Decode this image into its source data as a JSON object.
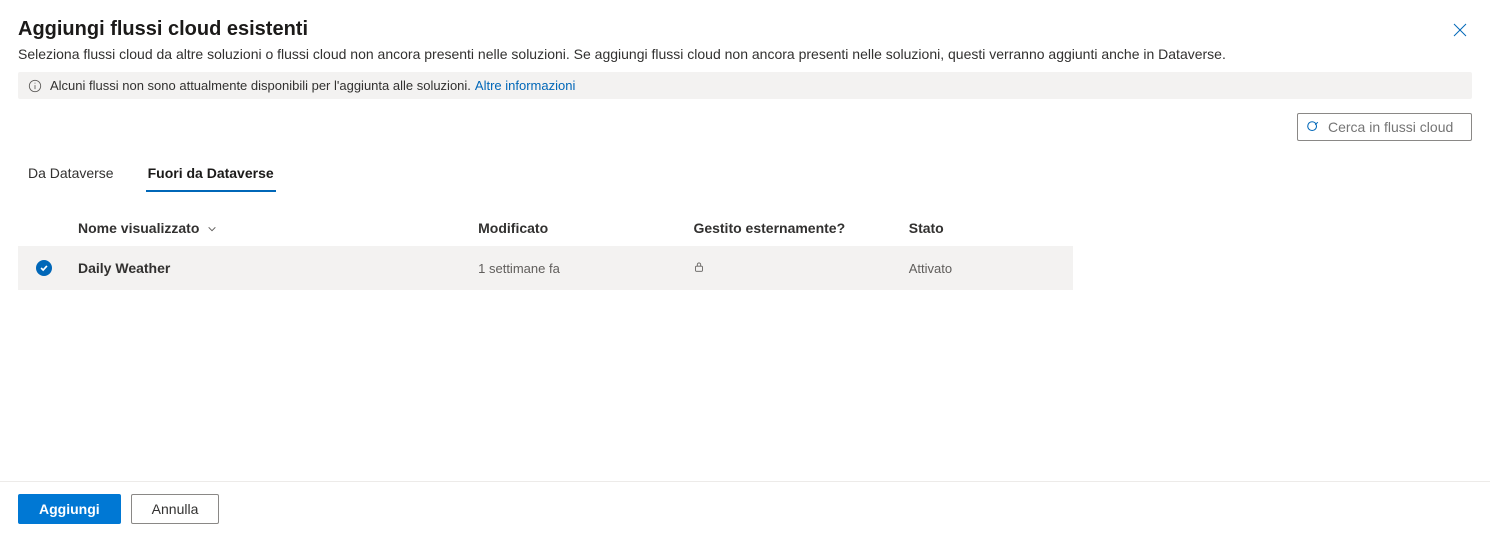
{
  "header": {
    "title": "Aggiungi flussi cloud esistenti",
    "subtitle": "Seleziona flussi cloud da altre soluzioni o flussi cloud non ancora presenti nelle soluzioni. Se aggiungi flussi cloud non ancora presenti nelle soluzioni, questi verranno aggiunti anche in Dataverse."
  },
  "info_bar": {
    "text": "Alcuni flussi non sono attualmente disponibili per l'aggiunta alle soluzioni.",
    "link_text": "Altre informazioni"
  },
  "search": {
    "placeholder": "Cerca in flussi cloud"
  },
  "tabs": [
    {
      "label": "Da Dataverse",
      "active": false
    },
    {
      "label": "Fuori da Dataverse",
      "active": true
    }
  ],
  "table": {
    "columns": {
      "name": "Nome visualizzato",
      "modified": "Modificato",
      "managed": "Gestito esternamente?",
      "state": "Stato"
    },
    "rows": [
      {
        "selected": true,
        "name": "Daily Weather",
        "modified": "1 settimane fa",
        "managed_icon": "lock",
        "state": "Attivato"
      }
    ]
  },
  "footer": {
    "primary": "Aggiungi",
    "secondary": "Annulla"
  }
}
